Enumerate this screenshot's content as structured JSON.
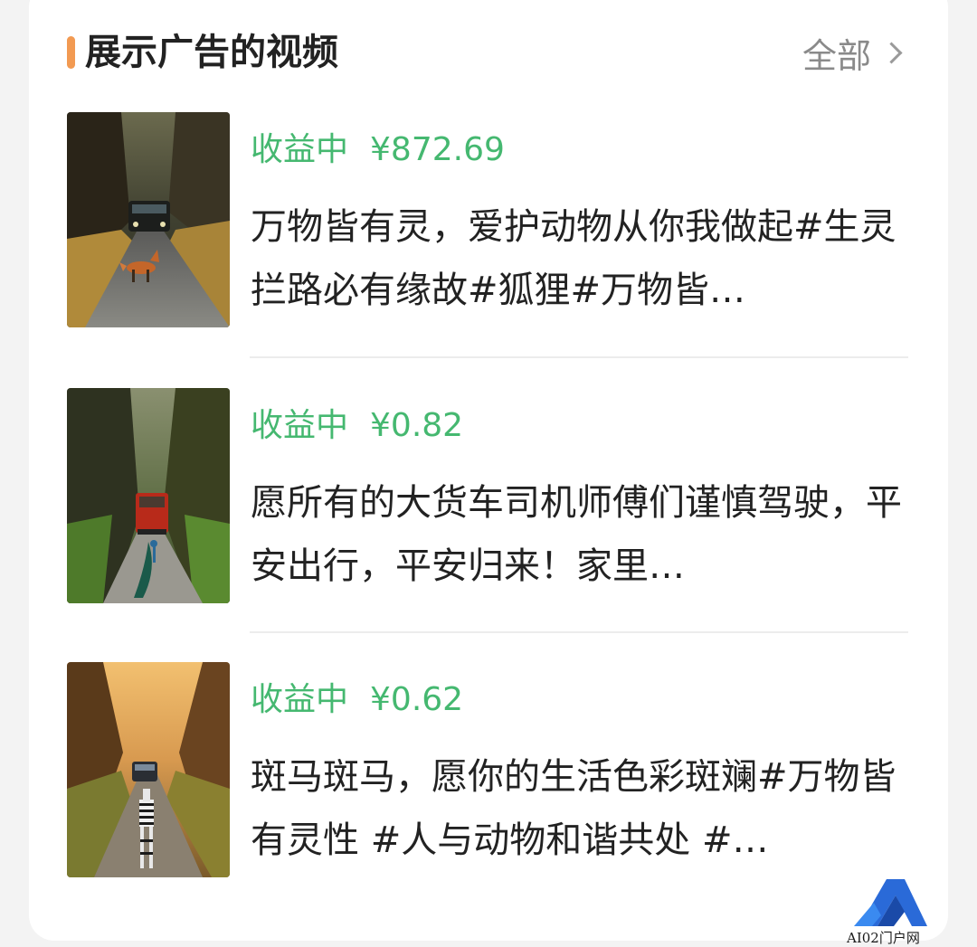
{
  "section": {
    "title": "展示广告的视频",
    "all_label": "全部"
  },
  "videos": [
    {
      "status": "收益中",
      "amount": "¥872.69",
      "description": "万物皆有灵，爱护动物从你我做起#生灵拦路必有缘故#狐狸#万物皆…",
      "thumbnail": "fox-and-jeep-on-road"
    },
    {
      "status": "收益中",
      "amount": "¥0.82",
      "description": "愿所有的大货车司机师傅们谨慎驾驶，平安出行，平安归来！家里…",
      "thumbnail": "peacock-and-truck-in-canyon"
    },
    {
      "status": "收益中",
      "amount": "¥0.62",
      "description": "斑马斑马，愿你的生活色彩斑斓#万物皆有灵性 #人与动物和谐共处 #…",
      "thumbnail": "zebra-and-car-at-sunset"
    }
  ],
  "watermark": {
    "text": "AI02门户网"
  },
  "colors": {
    "accent": "#f29a52",
    "earning": "#45b870",
    "title": "#222222",
    "muted": "#8a8a8a"
  }
}
